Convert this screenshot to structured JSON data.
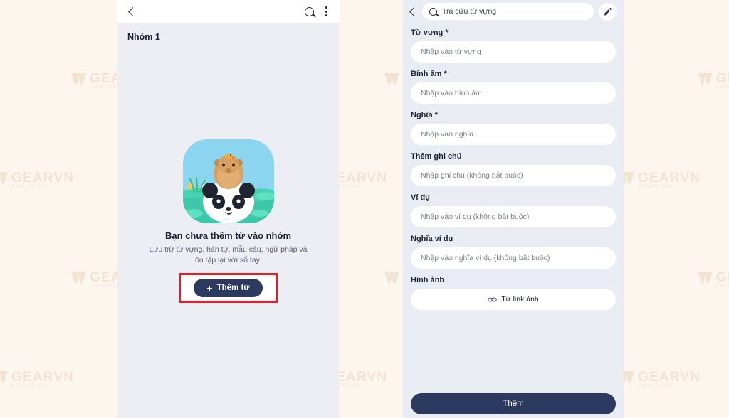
{
  "watermark": {
    "text": "GEARVN",
    "subtext": "COMPUTER"
  },
  "colors": {
    "navy": "#2b3a5e",
    "highlight_red": "#ec1c24",
    "page_bg": "#fdf6ee",
    "panel_bg": "#e9ecf2",
    "sky": "#8bd5f0"
  },
  "left_panel": {
    "topbar": {
      "back_icon": "back-chevron-icon",
      "search_icon": "search-icon",
      "overflow_icon": "kebab-menu-icon"
    },
    "group_title": "Nhóm 1",
    "illustration": {
      "name": "panda-capybara-illustration"
    },
    "empty_state": {
      "title": "Bạn chưa thêm từ vào nhóm",
      "subtitle": "Lưu trữ từ vựng, hán tự, mẫu câu, ngữ pháp và ôn tập lại với sổ tay.",
      "add_button_label": "Thêm từ",
      "add_button_plus": "+"
    }
  },
  "right_panel": {
    "topbar": {
      "back_icon": "back-chevron-icon",
      "search_icon": "search-icon",
      "search_placeholder": "Tra cứu từ vựng",
      "edit_icon": "pencil-icon"
    },
    "fields": [
      {
        "label": "Từ vựng *",
        "placeholder": "Nhập vào từ vựng",
        "name": "vocabulary"
      },
      {
        "label": "Bính âm *",
        "placeholder": "Nhập vào bính âm",
        "name": "pinyin"
      },
      {
        "label": "Nghĩa *",
        "placeholder": "Nhập vào nghĩa",
        "name": "meaning"
      },
      {
        "label": "Thêm ghi chú",
        "placeholder": "Nhập ghi chú (không bắt buộc)",
        "name": "note"
      },
      {
        "label": "Ví dụ",
        "placeholder": "Nhập vào ví dụ (không bắt buộc)",
        "name": "example"
      },
      {
        "label": "Nghĩa ví dụ",
        "placeholder": "Nhập vào nghĩa ví dụ (không bắt buộc)",
        "name": "example-meaning"
      }
    ],
    "image_field": {
      "label": "Hình ảnh",
      "button_label": "Từ link ảnh",
      "button_icon": "link-icon"
    },
    "submit_label": "Thêm"
  }
}
